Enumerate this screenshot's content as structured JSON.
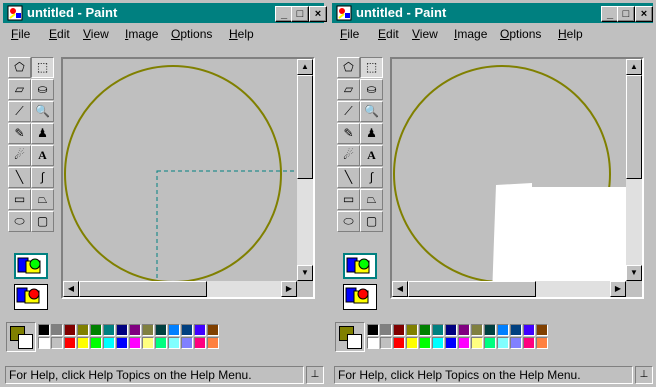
{
  "windows": [
    {
      "id": "before",
      "title": "untitled - Paint",
      "menus": [
        "File",
        "Edit",
        "View",
        "Image",
        "Options",
        "Help"
      ],
      "status": "For Help, click Help Topics on the Help Menu."
    },
    {
      "id": "after",
      "title": "untitled - Paint",
      "menus": [
        "File",
        "Edit",
        "View",
        "Image",
        "Options",
        "Help"
      ],
      "status": "For Help, click Help Topics on the Help Menu."
    }
  ],
  "title_buttons": {
    "minimize": "_",
    "maximize": "□",
    "close": "×"
  },
  "tools": [
    {
      "name": "free-form-select-icon",
      "glyph": "⬠"
    },
    {
      "name": "select-icon",
      "glyph": "⬚"
    },
    {
      "name": "eraser-icon",
      "glyph": "▱"
    },
    {
      "name": "fill-icon",
      "glyph": "⛀"
    },
    {
      "name": "pick-color-icon",
      "glyph": "⟋"
    },
    {
      "name": "magnifier-icon",
      "glyph": "🔍"
    },
    {
      "name": "pencil-icon",
      "glyph": "✎"
    },
    {
      "name": "brush-icon",
      "glyph": "♟"
    },
    {
      "name": "airbrush-icon",
      "glyph": "☄"
    },
    {
      "name": "text-icon",
      "glyph": "A"
    },
    {
      "name": "line-icon",
      "glyph": "╲"
    },
    {
      "name": "curve-icon",
      "glyph": "∫"
    },
    {
      "name": "rectangle-icon",
      "glyph": "▭"
    },
    {
      "name": "polygon-icon",
      "glyph": "⏢"
    },
    {
      "name": "ellipse-icon",
      "glyph": "⬭"
    },
    {
      "name": "rounded-rectangle-icon",
      "glyph": "▢"
    }
  ],
  "colors": {
    "foreground": "#808000",
    "background": "#ffffff",
    "title_bar": "#008080",
    "circle": "#808000",
    "selection": "#008080",
    "palette_top": [
      "#000000",
      "#808080",
      "#800000",
      "#808000",
      "#008000",
      "#008080",
      "#000080",
      "#800080",
      "#808040",
      "#004040",
      "#0080ff",
      "#004080",
      "#4000ff",
      "#804000"
    ],
    "palette_bottom": [
      "#ffffff",
      "#c0c0c0",
      "#ff0000",
      "#ffff00",
      "#00ff00",
      "#00ffff",
      "#0000ff",
      "#ff00ff",
      "#ffff80",
      "#00ff80",
      "#80ffff",
      "#8080ff",
      "#ff0080",
      "#ff8040"
    ]
  },
  "status_corner_icon": "resize-grip-icon"
}
